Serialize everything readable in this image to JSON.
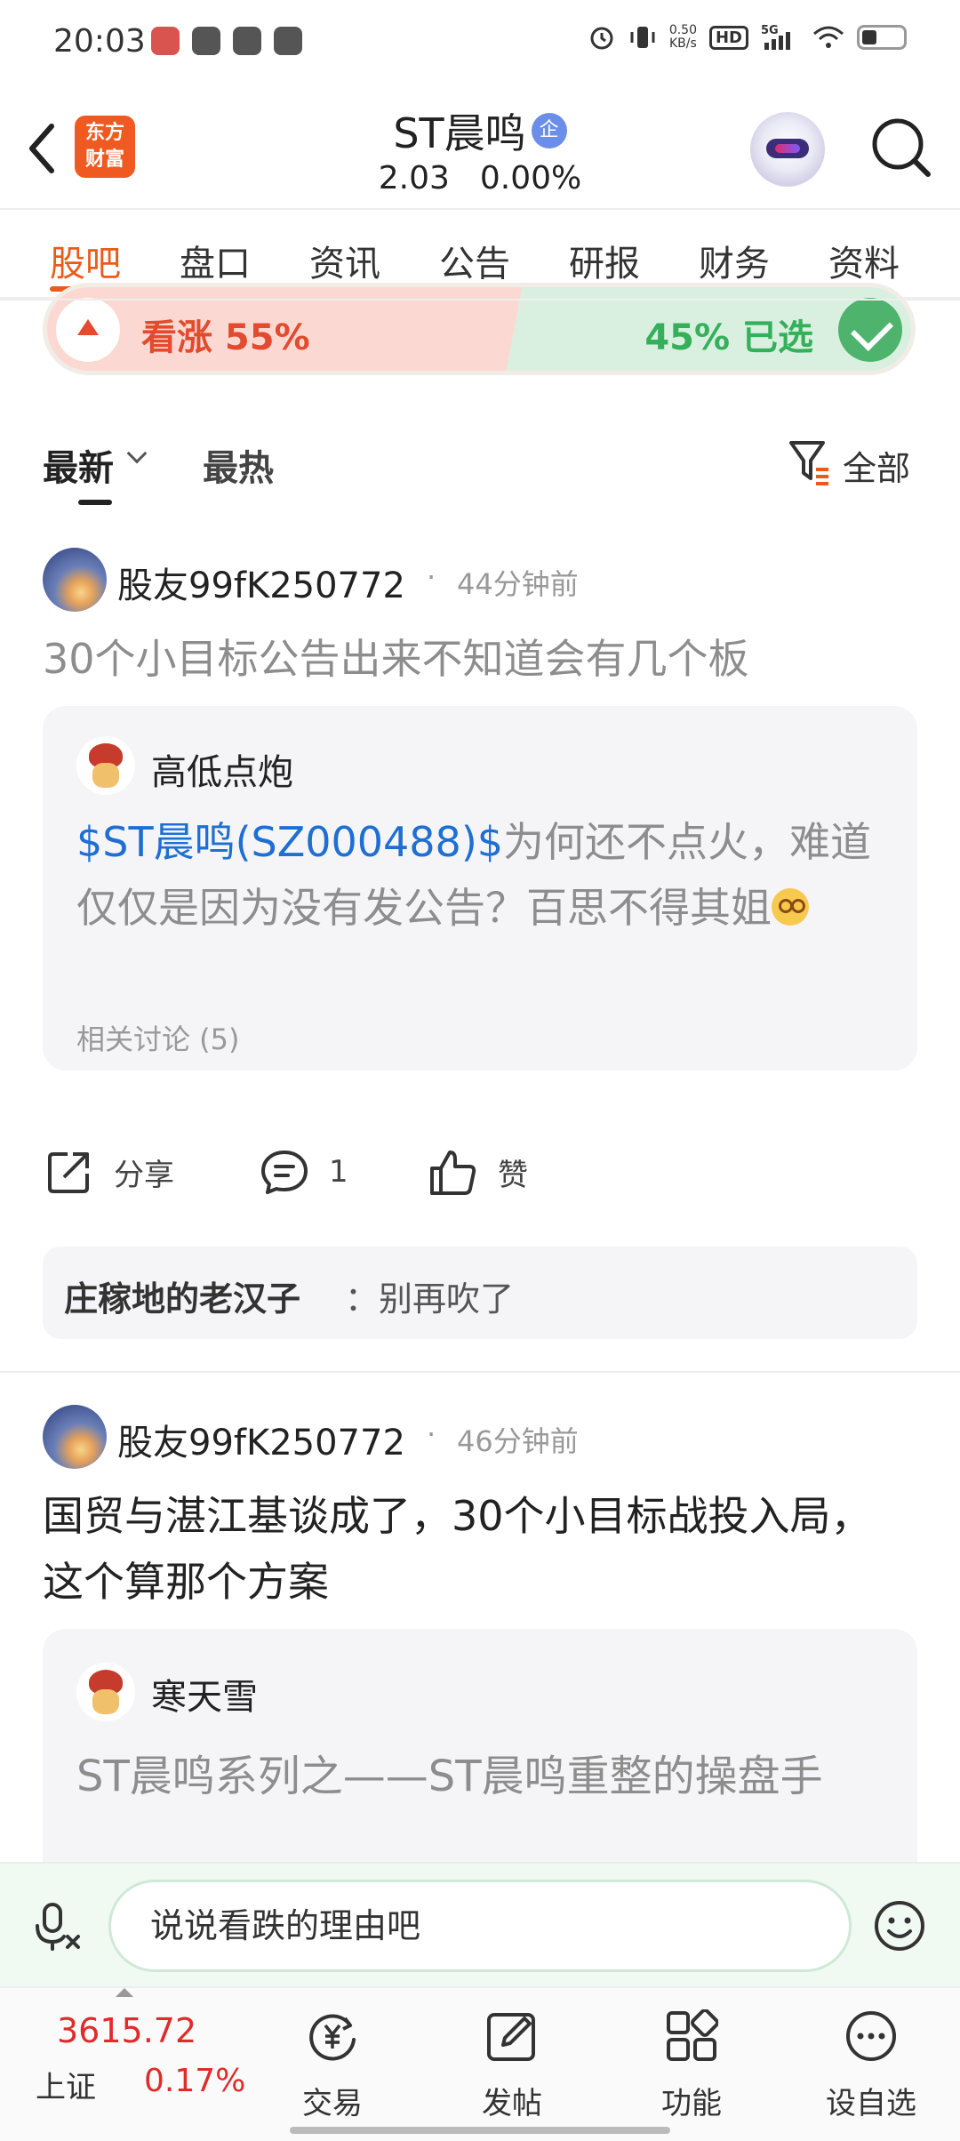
{
  "status_bar": {
    "time": "20:03",
    "network_speed": "0.50",
    "network_speed_unit": "KB/s",
    "hd_label": "HD",
    "signal_label": "5G"
  },
  "header": {
    "logo_text_line1": "东方",
    "logo_text_line2": "财富",
    "stock_name": "ST晨鸣",
    "badge": "企",
    "price": "2.03",
    "change_pct": "0.00%"
  },
  "tabs": [
    {
      "label": "股吧",
      "active": true
    },
    {
      "label": "盘口"
    },
    {
      "label": "资讯"
    },
    {
      "label": "公告"
    },
    {
      "label": "研报"
    },
    {
      "label": "财务"
    },
    {
      "label": "资料"
    }
  ],
  "vote": {
    "up_label": "看涨 55%",
    "up_fraction": 0.55,
    "down_label": "45% 已选",
    "down_fraction": 0.45
  },
  "sort": {
    "latest": "最新",
    "hot": "最热",
    "filter_label": "全部"
  },
  "posts": [
    {
      "author": "股友99fK250772",
      "separator": "·",
      "time": "44分钟前",
      "title": "30个小目标公告出来不知道会有几个板",
      "quote": {
        "author": "高低点炮",
        "stock_link": "$ST晨鸣(SZ000488)$",
        "text": "为何还不点火，难道仅仅是因为没有发公告？百思不得其姐",
        "related": "相关讨论 (5)"
      },
      "actions": {
        "share": "分享",
        "comments": "1",
        "like": "赞"
      },
      "top_comment": {
        "author": "庄稼地的老汉子",
        "text": "：别再吹了"
      }
    },
    {
      "author": "股友99fK250772",
      "separator": "·",
      "time": "46分钟前",
      "title": "国贸与湛江基谈成了，30个小目标战投入局，这个算那个方案",
      "quote": {
        "author": "寒天雪",
        "title": "ST晨鸣系列之——ST晨鸣重整的操盘手"
      }
    }
  ],
  "comment_input": {
    "placeholder": "说说看跌的理由吧"
  },
  "bottom_nav": {
    "index_value": "3615.72",
    "index_name": "上证",
    "index_change": "0.17%",
    "items": [
      {
        "label": "交易",
        "icon": "trade-yen-icon"
      },
      {
        "label": "发帖",
        "icon": "compose-icon"
      },
      {
        "label": "功能",
        "icon": "grid-icon"
      },
      {
        "label": "设自选",
        "icon": "more-icon"
      }
    ]
  },
  "colors": {
    "accent": "#ea5b1b",
    "up_red": "#e24b2e",
    "down_green": "#35b05a",
    "link_blue": "#1f6fd3"
  }
}
